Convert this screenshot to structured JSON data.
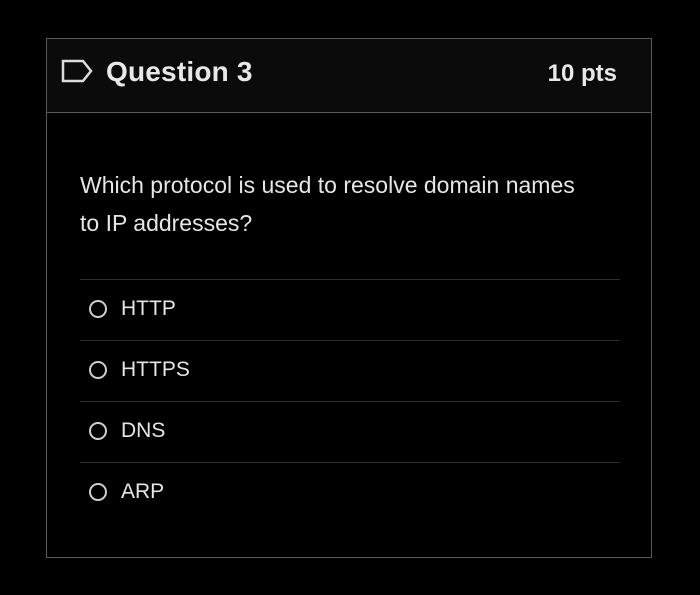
{
  "question": {
    "title": "Question 3",
    "points": "10 pts",
    "flag_icon": "flag-outline-icon",
    "text": "Which protocol is used to resolve domain names to IP addresses?",
    "answers": [
      {
        "label": "HTTP",
        "selected": false
      },
      {
        "label": "HTTPS",
        "selected": false
      },
      {
        "label": "DNS",
        "selected": false
      },
      {
        "label": "ARP",
        "selected": false
      }
    ]
  },
  "colors": {
    "background": "#000000",
    "border": "#5a5a5a",
    "text": "#e6e6e6"
  }
}
